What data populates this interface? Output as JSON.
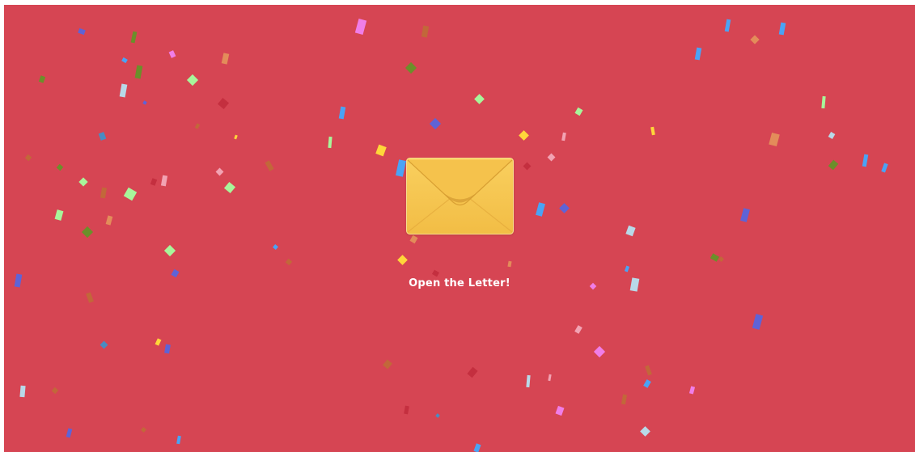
{
  "page": {
    "background": "#d64553"
  },
  "envelope": {
    "icon": "envelope-icon",
    "color": "#f7c654"
  },
  "cta": {
    "label": "Open the Letter!"
  },
  "confetti": {
    "palette": [
      "#4aa3f5",
      "#f07ee8",
      "#a8f59a",
      "#ffd63a",
      "#6b8f2a",
      "#c2673a",
      "#5f63d6",
      "#b8d9e8",
      "#e38c5a",
      "#c42f3f",
      "#f2a3b3",
      "#4a8bc2"
    ]
  }
}
